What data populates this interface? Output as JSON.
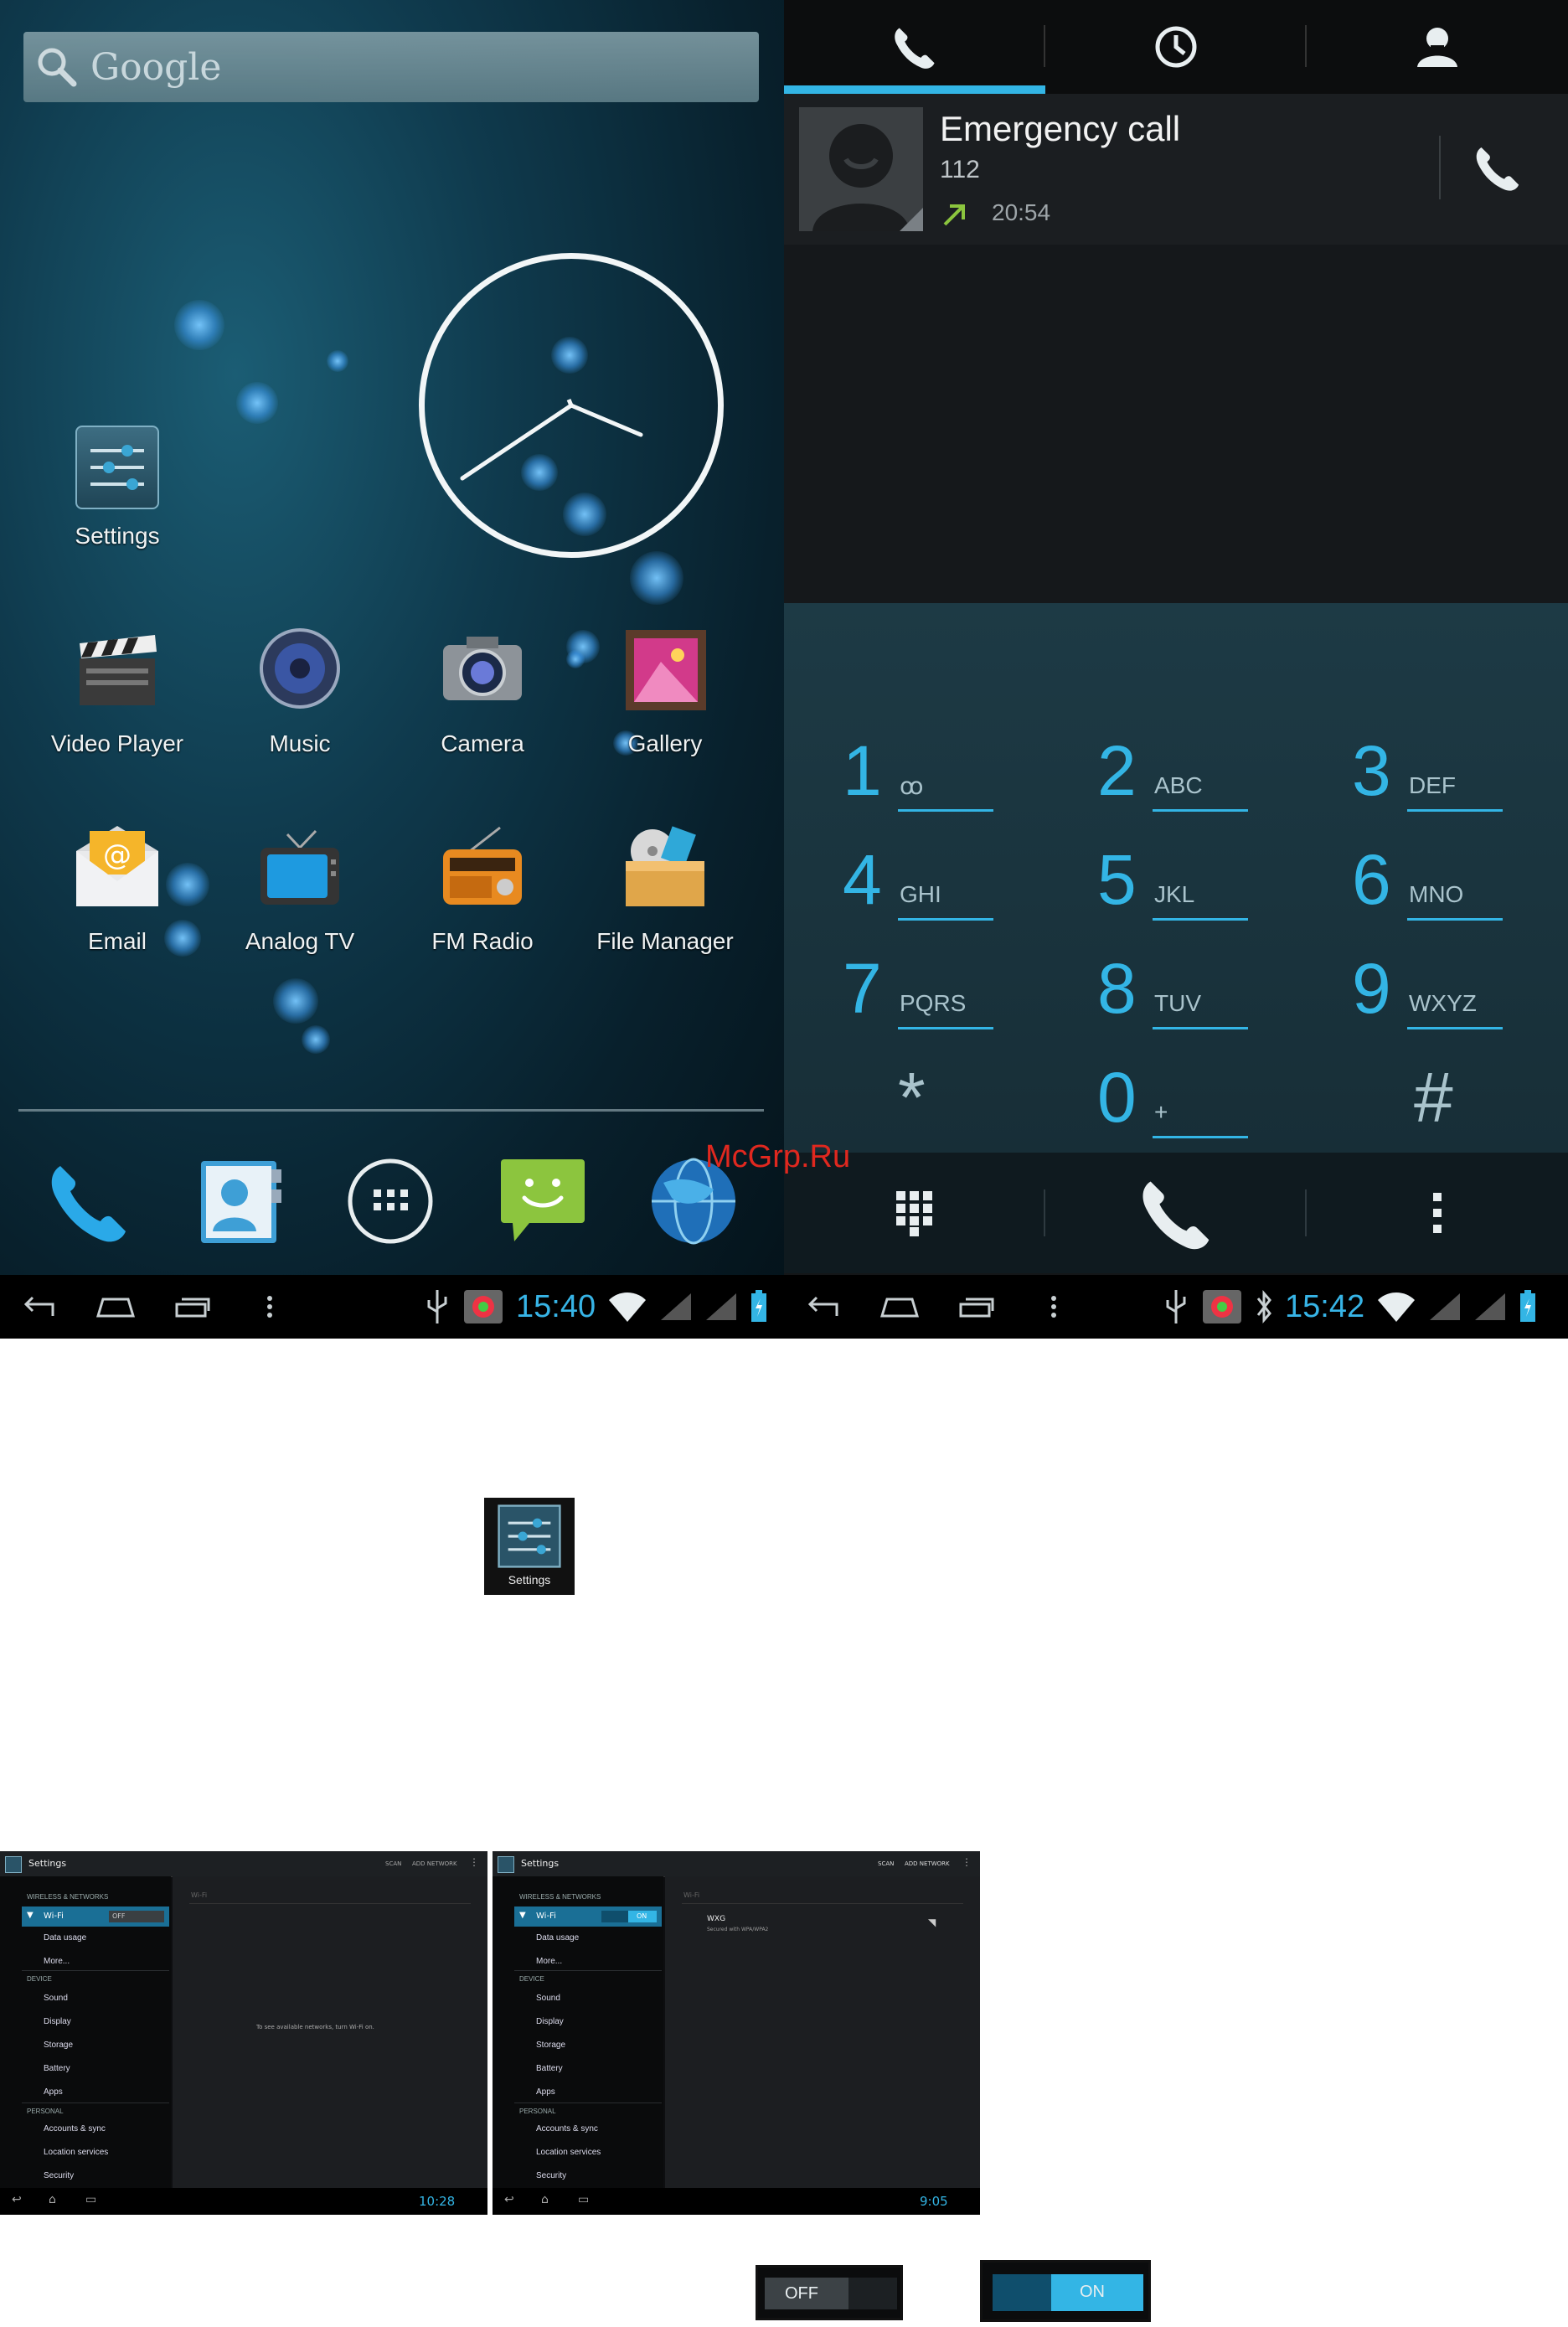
{
  "home": {
    "search_label": "Google",
    "apps": [
      {
        "label": "Settings"
      },
      {
        "label": "Video Player"
      },
      {
        "label": "Music"
      },
      {
        "label": "Camera"
      },
      {
        "label": "Gallery"
      },
      {
        "label": "Email"
      },
      {
        "label": "Analog TV"
      },
      {
        "label": "FM Radio"
      },
      {
        "label": "File Manager"
      }
    ],
    "status_time": "15:40"
  },
  "dialer": {
    "call_log": {
      "name": "Emergency call",
      "number": "112",
      "time": "20:54"
    },
    "keys": [
      {
        "digit": "1",
        "letters": "ꝏ"
      },
      {
        "digit": "2",
        "letters": "ABC"
      },
      {
        "digit": "3",
        "letters": "DEF"
      },
      {
        "digit": "4",
        "letters": "GHI"
      },
      {
        "digit": "5",
        "letters": "JKL"
      },
      {
        "digit": "6",
        "letters": "MNO"
      },
      {
        "digit": "7",
        "letters": "PQRS"
      },
      {
        "digit": "8",
        "letters": "TUV"
      },
      {
        "digit": "9",
        "letters": "WXYZ"
      },
      {
        "digit": "*",
        "letters": ""
      },
      {
        "digit": "0",
        "letters": "+"
      },
      {
        "digit": "#",
        "letters": ""
      }
    ],
    "status_time": "15:42"
  },
  "watermark": "McGrp.Ru",
  "settings_icon_label": "Settings",
  "settings_shots": [
    {
      "title": "Settings",
      "actions": [
        "SCAN",
        "ADD NETWORK"
      ],
      "wifi_state": "OFF",
      "content_header": "Wi-Fi",
      "content_message": "To see available networks, turn Wi-Fi on.",
      "time": "10:28"
    },
    {
      "title": "Settings",
      "actions": [
        "SCAN",
        "ADD NETWORK"
      ],
      "wifi_state": "ON",
      "content_header": "Wi-Fi",
      "network_name": "WXG",
      "network_status": "Secured with WPA/WPA2",
      "time": "9:05"
    }
  ],
  "settings_menu": {
    "sections": {
      "wireless": "WIRELESS & NETWORKS",
      "device": "DEVICE",
      "personal": "PERSONAL"
    },
    "items": [
      "Wi-Fi",
      "Data usage",
      "More...",
      "Sound",
      "Display",
      "Storage",
      "Battery",
      "Apps",
      "Accounts & sync",
      "Location services",
      "Security"
    ]
  },
  "toggles": {
    "off": "OFF",
    "on": "ON"
  },
  "colors": {
    "accent": "#33b5e5",
    "nav_bg": "#000000"
  }
}
